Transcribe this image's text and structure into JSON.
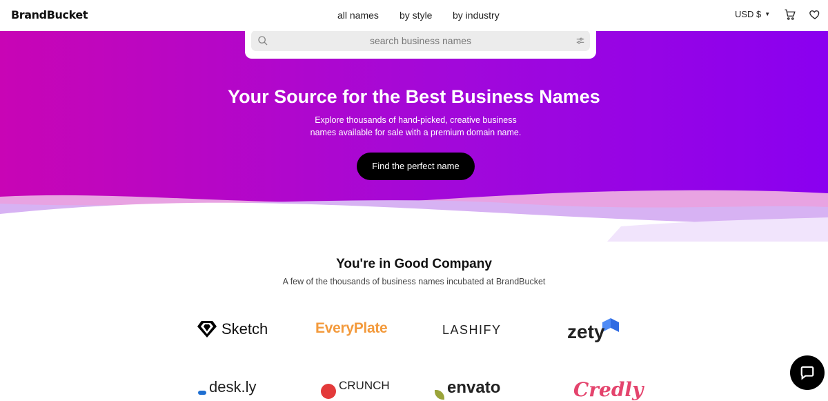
{
  "header": {
    "logo": "BrandBucket",
    "nav": [
      "all names",
      "by style",
      "by industry"
    ],
    "currency": "USD $"
  },
  "search": {
    "placeholder": "search business names"
  },
  "hero": {
    "title": "Your Source for the Best Business Names",
    "subtitle_line1": "Explore thousands of hand-picked, creative business",
    "subtitle_line2": "names available for sale with a premium domain name.",
    "cta": "Find the perfect name"
  },
  "company": {
    "title": "You're in Good Company",
    "subtitle": "A few of the thousands of business names incubated at BrandBucket",
    "brands_row1": [
      "Sketch",
      "EveryPlate",
      "LASHIFY",
      "zety"
    ],
    "brands_row2": [
      "desk.ly",
      "CRUNCH",
      "envato",
      "Credly"
    ]
  },
  "colors": {
    "hero_gradient_start": "#c805b5",
    "hero_gradient_end": "#8a00f0",
    "cta_background": "#000000",
    "everyplate": "#f39a3c",
    "credly": "#e4446d"
  },
  "icons": [
    "search-icon",
    "filter-icon",
    "cart-icon",
    "heart-icon",
    "chat-icon",
    "caret-down-icon"
  ]
}
